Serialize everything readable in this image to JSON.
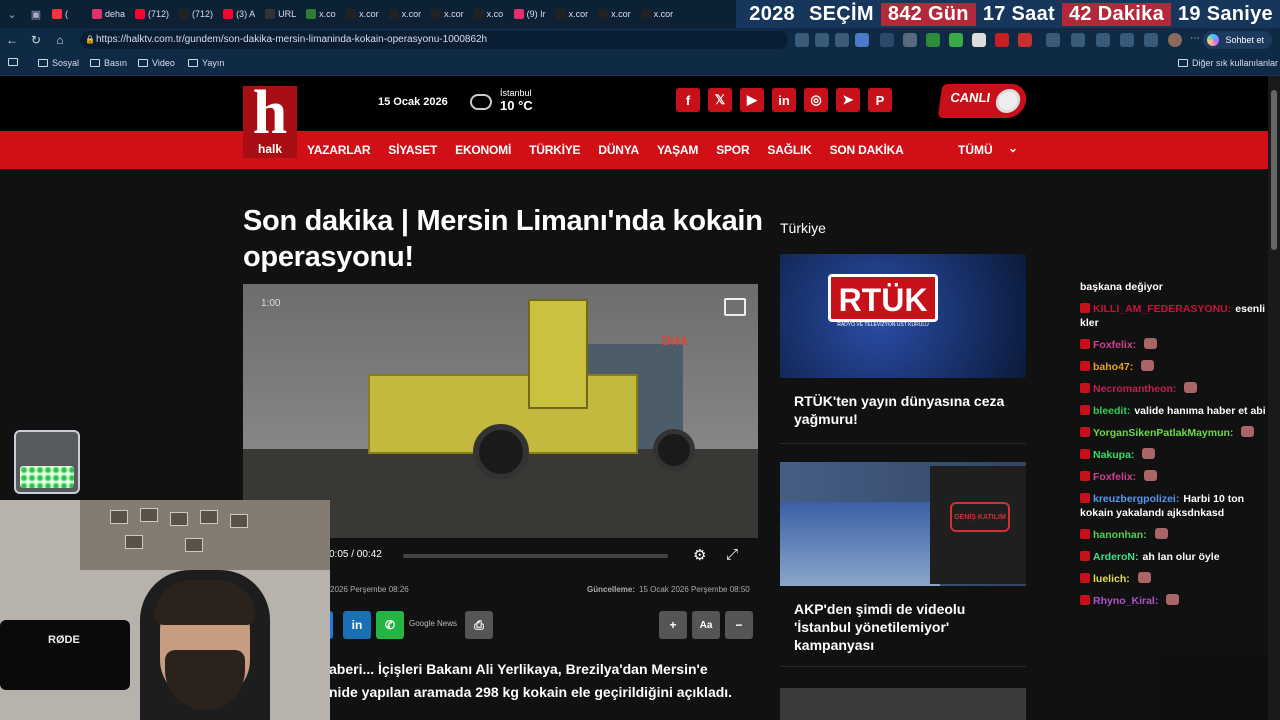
{
  "browser": {
    "tabs": [
      {
        "label": "(",
        "favicon_color": "#ff3040"
      },
      {
        "label": "deha",
        "favicon_color": "#e1306c"
      },
      {
        "label": "(712)",
        "favicon_color": "#ff0033"
      },
      {
        "label": "(712)",
        "favicon_color": "#222222"
      },
      {
        "label": "(3) A",
        "favicon_color": "#ff0033"
      },
      {
        "label": "URL",
        "favicon_color": "#333333"
      },
      {
        "label": "x.co",
        "favicon_color": "#2e7d32"
      },
      {
        "label": "x.cor",
        "favicon_color": "#222222"
      },
      {
        "label": "x.cor",
        "favicon_color": "#222222"
      },
      {
        "label": "x.cor",
        "favicon_color": "#222222"
      },
      {
        "label": "x.co",
        "favicon_color": "#222222"
      },
      {
        "label": "(9) Ir",
        "favicon_color": "#e1306c"
      },
      {
        "label": "x.cor",
        "favicon_color": "#222222"
      },
      {
        "label": "x.cor",
        "favicon_color": "#222222"
      },
      {
        "label": "x.cor",
        "favicon_color": "#222222"
      }
    ],
    "url": "https://halktv.com.tr/gundem/son-dakika-mersin-limaninda-kokain-operasyonu-1000862h",
    "profile_label": "Sohbet et",
    "bookmarks": [
      "Sosyal",
      "Basın",
      "Video",
      "Yayın"
    ],
    "other_bookmarks": "Diğer sık kullanılanlar"
  },
  "counter": {
    "year": "2028",
    "label": "SEÇİM",
    "days": "842 Gün",
    "hours": "17 Saat",
    "minutes": "42 Dakika",
    "seconds": "19 Saniye"
  },
  "site": {
    "logo_word": "halk",
    "logo_letter": "h",
    "date": "15 Ocak 2026",
    "weather_city": "İstanbul",
    "weather_temp": "10 °C",
    "live_label": "CANLI",
    "social": [
      "f",
      "𝕏",
      "▶",
      "in",
      "◎",
      "➤",
      "P"
    ],
    "menu": [
      "YAZARLAR",
      "SİYASET",
      "EKONOMİ",
      "TÜRKİYE",
      "DÜNYA",
      "YAŞAM",
      "SPOR",
      "SAĞLIK",
      "SON DAKİKA"
    ],
    "all_label": "TÜMÜ",
    "brand_red": "#d10f16"
  },
  "article": {
    "title": "Son dakika | Mersin Limanı'nda kokain operasyonu!",
    "video_overlay_time": "1:00",
    "video_watermark": "DHA",
    "video_time": "0:05 / 00:42",
    "published": "2026 Perşembe 08:26",
    "updated_label": "Güncelleme:",
    "updated": "15 Ocak 2026 Perşembe 08:50",
    "google_news": "Google News",
    "lead_line1": "aberi... İçişleri Bakanı Ali Yerlikaya, Brezilya'dan Mersin'e",
    "lead_line2": "nide yapılan aramada 298 kg kokain ele geçirildiğini açıkladı."
  },
  "sidebar": {
    "heading": "Türkiye",
    "cards": [
      {
        "title": "RTÜK'ten yayın dünyasına ceza yağmuru!",
        "thumb_text": "RTÜK",
        "thumb_sub": "RADYO VE TELEVİZYON ÜST KURULU"
      },
      {
        "title": "AKP'den şimdi de videolu 'İstanbul yönetilemiyor' kampanyası",
        "thumb_text": "GENİŞ KATILIM"
      }
    ]
  },
  "chat": [
    {
      "user": "",
      "text": "başkana değiyor",
      "color": "#ffffff"
    },
    {
      "user": "KILLI_AM_FEDERASYONU:",
      "text": "esenli kler",
      "color": "#c8103a"
    },
    {
      "user": "Foxfelix:",
      "text": "",
      "color": "#d04090"
    },
    {
      "user": "baho47:",
      "text": "",
      "color": "#e8a020"
    },
    {
      "user": "Necromantheon:",
      "text": "",
      "color": "#c02050"
    },
    {
      "user": "bleedit:",
      "text": "valide hanıma haber et abi",
      "color": "#33cc55"
    },
    {
      "user": "YorganSikenPatlakMaymun:",
      "text": "",
      "color": "#66dd44"
    },
    {
      "user": "Nakupa:",
      "text": "",
      "color": "#33dd66"
    },
    {
      "user": "Foxfelix:",
      "text": "",
      "color": "#d04090"
    },
    {
      "user": "kreuzbergpolizei:",
      "text": "Harbi 10 ton kokain yakalandı ajksdnkasd",
      "color": "#5599ee"
    },
    {
      "user": "hanonhan:",
      "text": "",
      "color": "#55cc55"
    },
    {
      "user": "ArderoN:",
      "text": "ah lan olur öyle",
      "color": "#44dd88"
    },
    {
      "user": "luelich:",
      "text": "",
      "color": "#dddd55"
    },
    {
      "user": "Rhyno_Kiral:",
      "text": "",
      "color": "#aa55cc"
    }
  ],
  "webcam": {
    "mic_brand": "RØDE"
  }
}
